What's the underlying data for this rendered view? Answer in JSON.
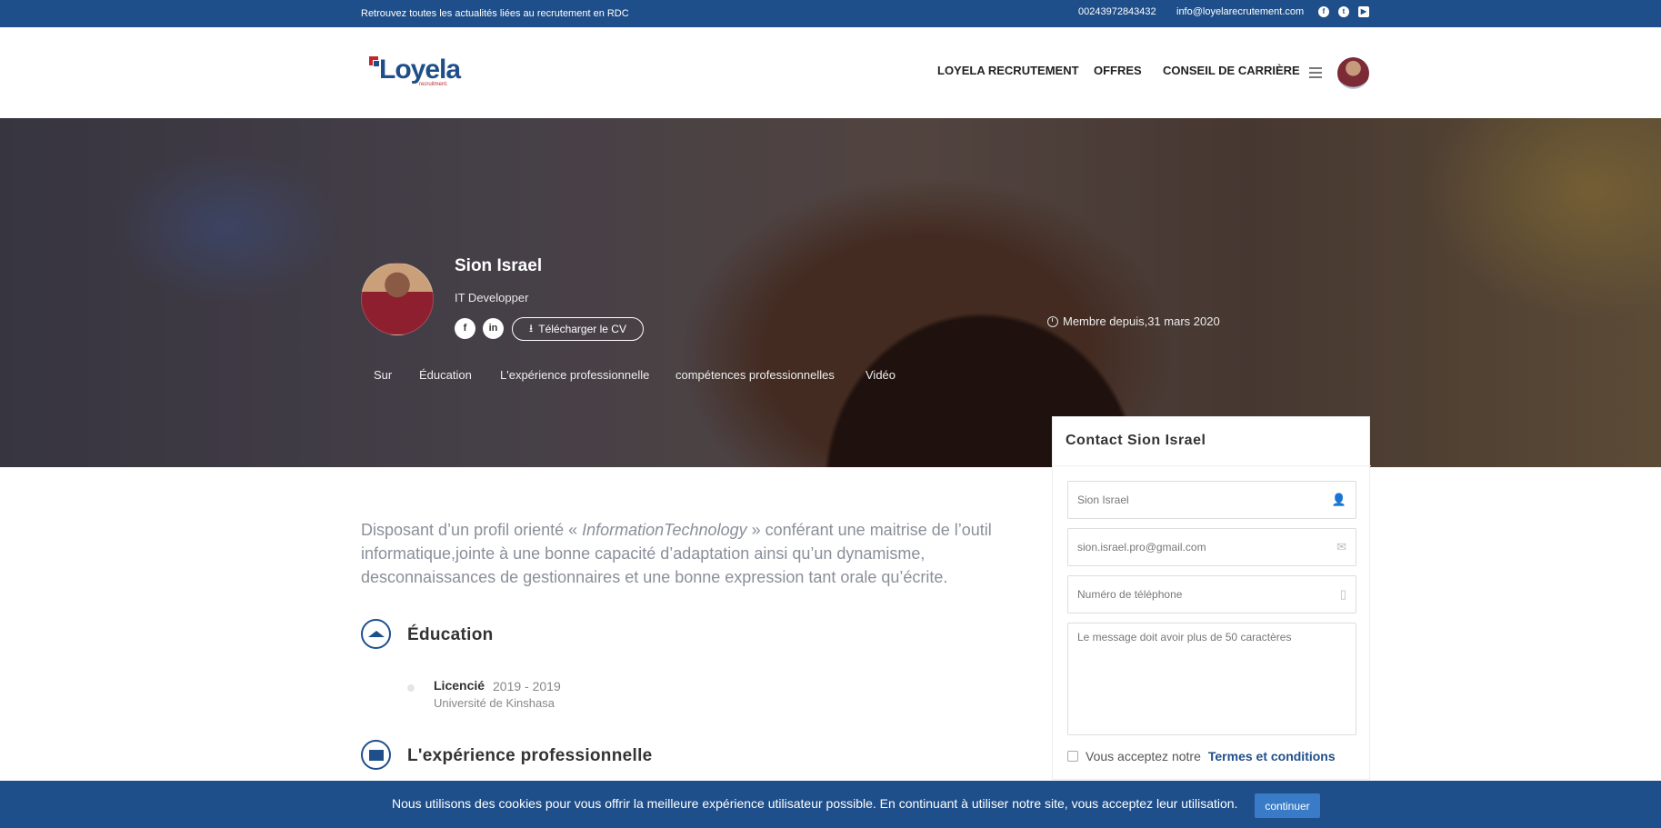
{
  "topbar": {
    "tagline": "Retrouvez toutes les actualités liées au recrutement en RDC",
    "phone": "00243972843432",
    "email": "info@loyelarecrutement.com",
    "social_icons": [
      "facebook-icon",
      "twitter-icon",
      "youtube-icon"
    ]
  },
  "header": {
    "logo_text": "Loyela",
    "logo_sub": "recruitment.",
    "nav": [
      "LOYELA RECRUTEMENT",
      "OFFRES",
      "CONSEIL DE CARRIÈRE"
    ]
  },
  "profile": {
    "name": "Sion Israel",
    "title": "IT Developper",
    "social": [
      "f",
      "in"
    ],
    "cv_button": "Télécharger le CV",
    "member_since": "Membre depuis,31 mars 2020",
    "tabs": [
      "Sur",
      "Éducation",
      "L'expérience professionnelle",
      "compétences professionnelles",
      "Vidéo"
    ]
  },
  "contact": {
    "title": "Contact Sion Israel",
    "name_value": "Sion Israel",
    "email_value": "sion.israel.pro@gmail.com",
    "phone_placeholder": "Numéro de téléphone",
    "message_placeholder": "Le message doit avoir plus de 50 caractères",
    "terms_prefix": "Vous acceptez notre",
    "terms_link": "Termes et conditions"
  },
  "main": {
    "intro_before": "Disposant d’un profil orienté « ",
    "intro_italic": "InformationTechnology",
    "intro_after": " » conférant une maitrise de l’outil informatique,jointe à une bonne capacité d’adaptation ainsi qu’un dynamisme, desconnaissances de gestionnaires et une bonne expression tant orale qu’écrite.",
    "education_title": "Éducation",
    "education": [
      {
        "degree": "Licencié",
        "years": "2019 - 2019",
        "school": "Université de Kinshasa"
      }
    ],
    "experience_title": "L'expérience professionnelle"
  },
  "cookie": {
    "message": "Nous utilisons des cookies pour vous offrir la meilleure expérience utilisateur possible. En continuant à utiliser notre site, vous acceptez leur utilisation.",
    "button": "continuer"
  },
  "colors": {
    "brand_blue": "#1f4f8a",
    "brand_red": "#c2272d",
    "button_blue": "#3a7bc8"
  }
}
